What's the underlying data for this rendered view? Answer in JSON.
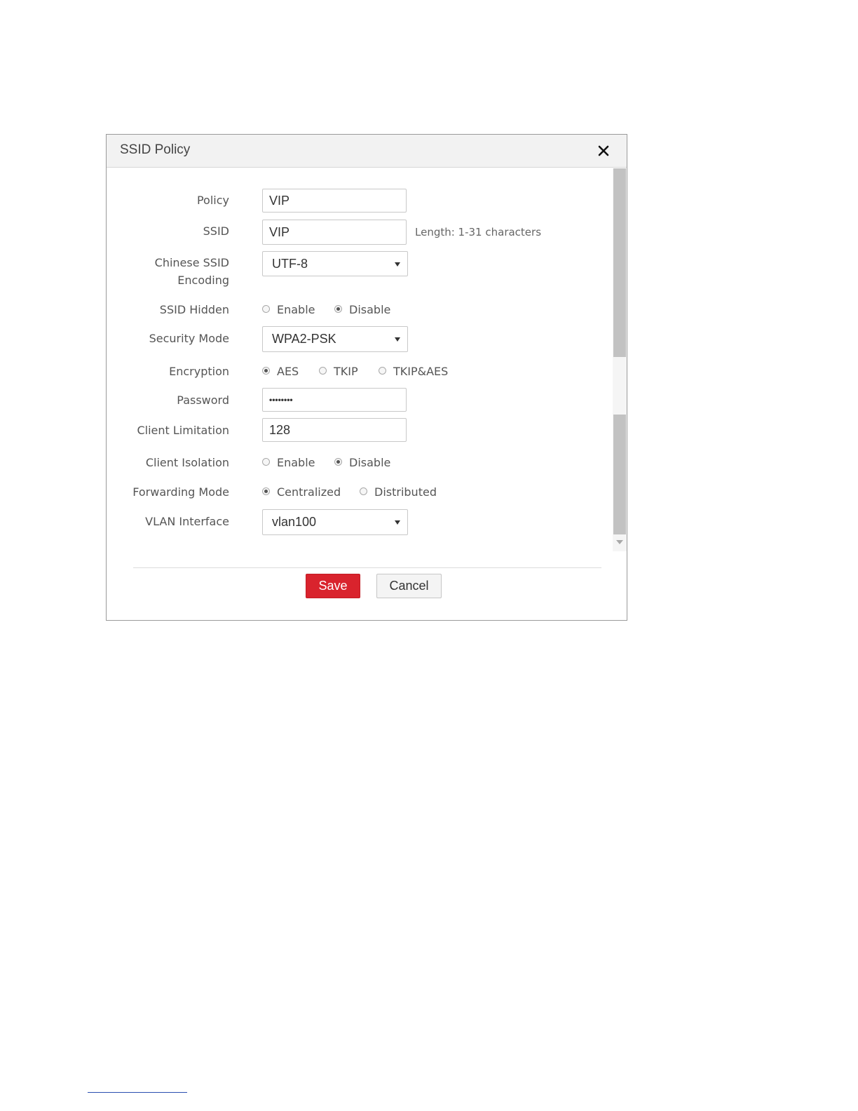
{
  "dialog": {
    "title": "SSID Policy",
    "close_icon": "close-icon"
  },
  "form": {
    "policy": {
      "label": "Policy",
      "value": "VIP"
    },
    "ssid": {
      "label": "SSID",
      "value": "VIP",
      "hint": "Length: 1-31 characters"
    },
    "chinese_ssid_encoding": {
      "label_line1": "Chinese SSID",
      "label_line2": "Encoding",
      "value": "UTF-8"
    },
    "ssid_hidden": {
      "label": "SSID Hidden",
      "options": [
        "Enable",
        "Disable"
      ],
      "selected": "Disable"
    },
    "security_mode": {
      "label": "Security Mode",
      "value": "WPA2-PSK"
    },
    "encryption": {
      "label": "Encryption",
      "options": [
        "AES",
        "TKIP",
        "TKIP&AES"
      ],
      "selected": "AES"
    },
    "password": {
      "label": "Password",
      "value": "••••••••"
    },
    "client_limitation": {
      "label": "Client Limitation",
      "value": "128"
    },
    "client_isolation": {
      "label": "Client Isolation",
      "options": [
        "Enable",
        "Disable"
      ],
      "selected": "Disable"
    },
    "forwarding_mode": {
      "label": "Forwarding Mode",
      "options": [
        "Centralized",
        "Distributed"
      ],
      "selected": "Centralized"
    },
    "vlan_interface": {
      "label": "VLAN Interface",
      "value": "vlan100"
    }
  },
  "buttons": {
    "save": "Save",
    "cancel": "Cancel"
  },
  "colors": {
    "save_button": "#d9232d",
    "header_bg": "#f2f2f2"
  }
}
